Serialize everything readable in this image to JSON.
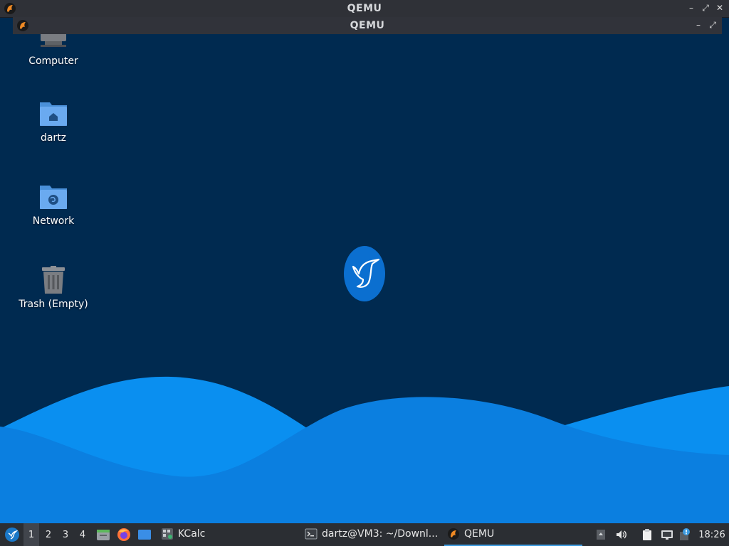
{
  "outer_window": {
    "title": "QEMU",
    "app_icon": "qemu-icon"
  },
  "inner_window": {
    "title": "QEMU",
    "app_icon": "qemu-icon"
  },
  "window_controls": {
    "minimize": "–",
    "restore": "⤢",
    "close": "✕"
  },
  "desktop": {
    "icons": [
      {
        "label": "Computer",
        "icon": "computer-icon"
      },
      {
        "label": "dartz",
        "icon": "home-folder-icon"
      },
      {
        "label": "Network",
        "icon": "network-folder-icon"
      },
      {
        "label": "Trash (Empty)",
        "icon": "trash-icon"
      }
    ],
    "center_logo": "hummingbird-logo-icon"
  },
  "taskbar": {
    "workspaces": [
      "1",
      "2",
      "3",
      "4"
    ],
    "active_workspace": "1",
    "launchers": [
      "file-manager-icon",
      "firefox-icon",
      "desktop-icon"
    ],
    "tasks": [
      {
        "label": "KCalc",
        "icon": "kcalc-icon"
      },
      {
        "label": "dartz@VM3: ~/Downl...",
        "icon": "terminal-icon"
      },
      {
        "label": "QEMU",
        "icon": "qemu-icon",
        "active": true
      }
    ],
    "tray": [
      "tray-expand-icon",
      "volume-icon",
      "clipboard-icon",
      "network-icon",
      "update-icon"
    ],
    "clock": "18:26"
  },
  "colors": {
    "desktop_bg": "#002a50",
    "wave_light": "#0a95ef",
    "wave_mid": "#0b7fe0",
    "taskbar_bg": "#2b2e33",
    "titlebar_bg": "#2f3137",
    "active_underline": "#3d9be0"
  }
}
